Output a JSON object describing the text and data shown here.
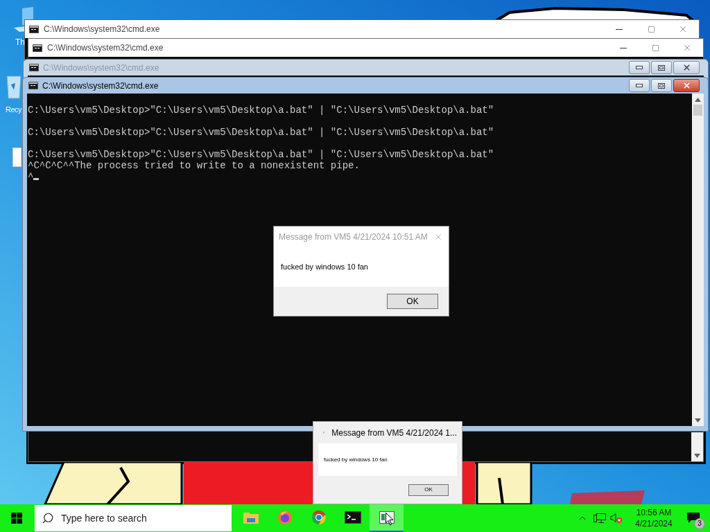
{
  "desktop_icons": [
    {
      "label": "Th"
    },
    {
      "label": "Recy"
    }
  ],
  "windows": [
    {
      "kind": "modern",
      "title": "C:\\Windows\\system32\\cmd.exe",
      "active": false
    },
    {
      "kind": "modern",
      "title": "C:\\Windows\\system32\\cmd.exe",
      "active": false
    },
    {
      "kind": "aero",
      "title": "C:\\Windows\\system32\\cmd.exe",
      "active": false
    },
    {
      "kind": "aero",
      "title": "C:\\Windows\\system32\\cmd.exe",
      "active": true,
      "console": [
        {
          "text": "C:\\Users\\vm5\\Desktop>\"C:\\Users\\vm5\\Desktop\\a.bat\" | \"C:\\Users\\vm5\\Desktop\\a.bat\"",
          "blank_after": true
        },
        {
          "text": "C:\\Users\\vm5\\Desktop>\"C:\\Users\\vm5\\Desktop\\a.bat\" | \"C:\\Users\\vm5\\Desktop\\a.bat\"",
          "blank_after": true
        },
        {
          "text": "C:\\Users\\vm5\\Desktop>\"C:\\Users\\vm5\\Desktop\\a.bat\" | \"C:\\Users\\vm5\\Desktop\\a.bat\"",
          "blank_after": false
        },
        {
          "text": "^C^C^C^^The process tried to write to a nonexistent pipe.",
          "blank_after": false
        },
        {
          "text": "^",
          "blank_after": false
        }
      ]
    }
  ],
  "message_box": {
    "title": "Message from VM5 4/21/2024 10:51 AM",
    "message": "fucked by windows 10 fan",
    "button": "OK"
  },
  "message_popup": {
    "title": "Message from VM5 4/21/2024 1...",
    "message": "fucked by windows 10 fan",
    "button": "OK"
  },
  "taskbar": {
    "search": {
      "placeholder": "Type here to search"
    },
    "apps": [
      {
        "kind": "folder",
        "selected": false
      },
      {
        "kind": "firefox",
        "selected": false
      },
      {
        "kind": "chrome",
        "selected": false
      },
      {
        "kind": "terminal",
        "selected": false
      },
      {
        "kind": "message",
        "selected": true
      }
    ],
    "time": "10:56 AM",
    "date": "4/21/2024",
    "notifications": "3"
  }
}
